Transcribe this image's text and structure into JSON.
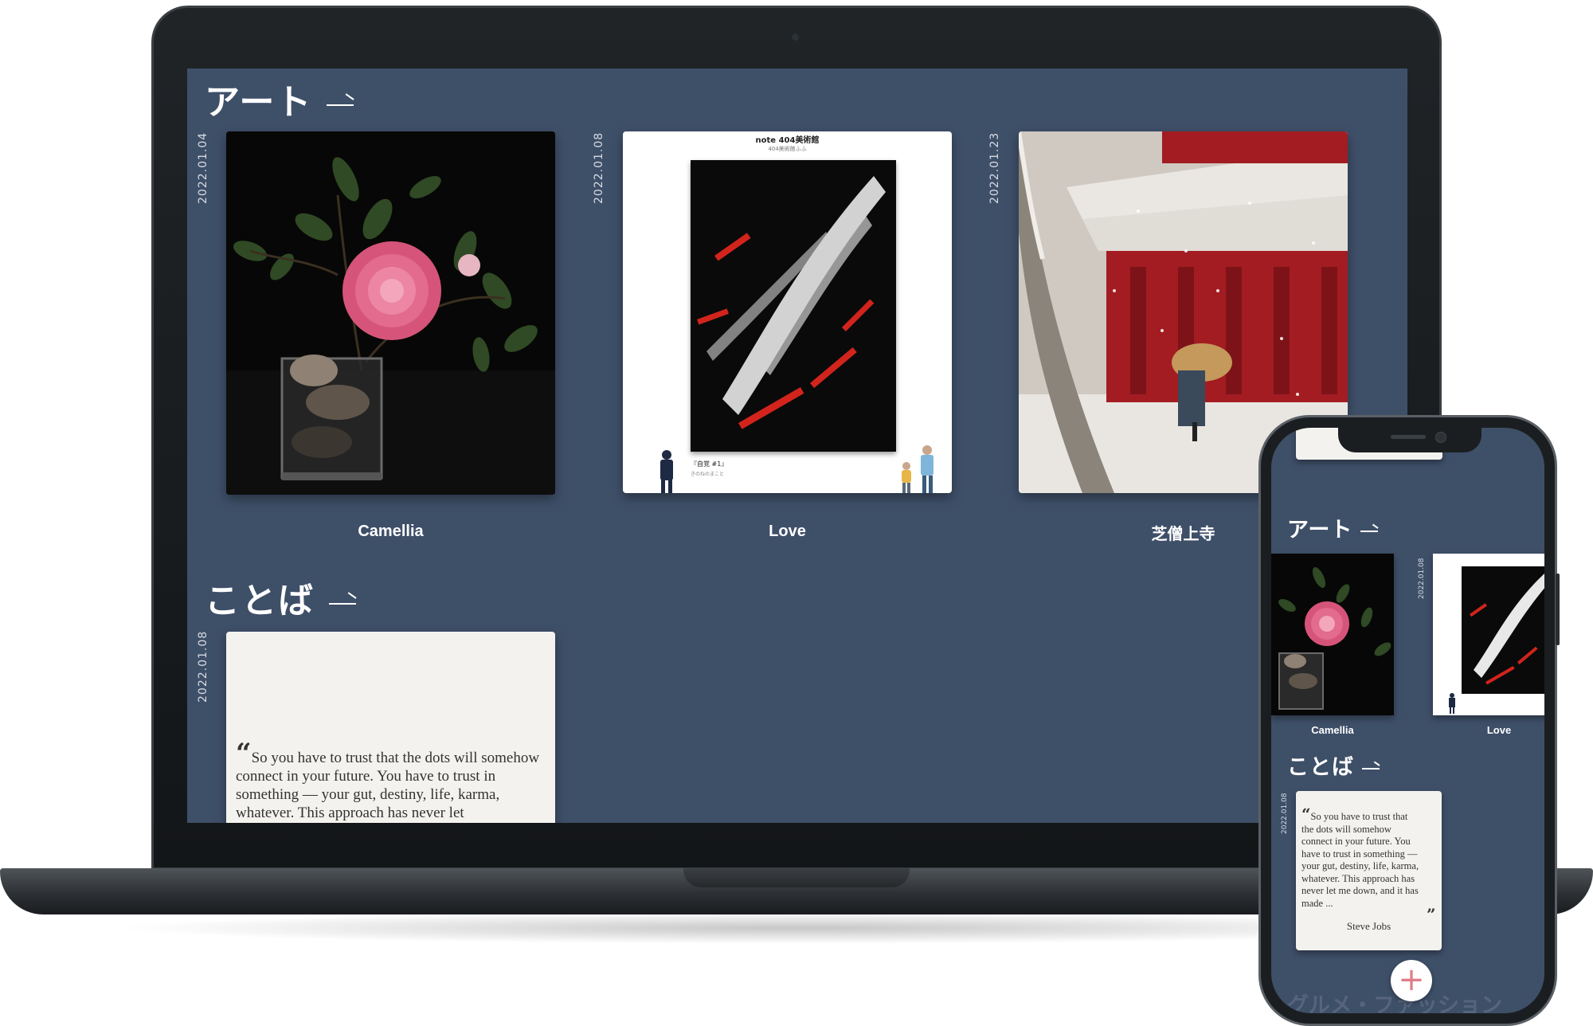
{
  "laptop": {
    "sections": {
      "art": {
        "title": "アート"
      },
      "kotoba": {
        "title": "ことば"
      }
    },
    "art_cards": [
      {
        "date": "2022.01.04",
        "caption": "Camellia"
      },
      {
        "date": "2022.01.08",
        "caption": "Love",
        "poster_title": "note 404美術館",
        "poster_subtitle": "404美術館ふふ",
        "poster_caption": "『自覚 #1』",
        "poster_caption_sub": "きのねのまこと"
      },
      {
        "date": "2022.01.23",
        "caption": "芝僧上寺"
      }
    ],
    "quote_card": {
      "date": "2022.01.08",
      "text": "So you have to trust that the dots will somehow connect in your future. You have to trust in something — your gut, destiny, life, karma, whatever. This approach has never let"
    }
  },
  "phone": {
    "sections": {
      "art": {
        "title": "アート"
      },
      "kotoba": {
        "title": "ことば"
      },
      "gourmet": {
        "title": "グルメ・ファッション"
      }
    },
    "art_cards": [
      {
        "caption": "Camellia"
      },
      {
        "date": "2022.01.08",
        "caption": "Love"
      }
    ],
    "quote_card": {
      "date": "2022.01.08",
      "lines": [
        "So you have to trust that",
        "the dots will somehow",
        "connect in your future. You",
        "have to trust in something —",
        "your gut, destiny, life, karma,",
        "whatever. This approach has",
        "never let me down, and it has",
        "made ..."
      ],
      "author": "Steve Jobs"
    },
    "fab_label": "+"
  },
  "colors": {
    "screen_bg": "#3e4f68",
    "accent_fab": "#e07f88",
    "quote_card_bg": "#f4f2ee"
  }
}
